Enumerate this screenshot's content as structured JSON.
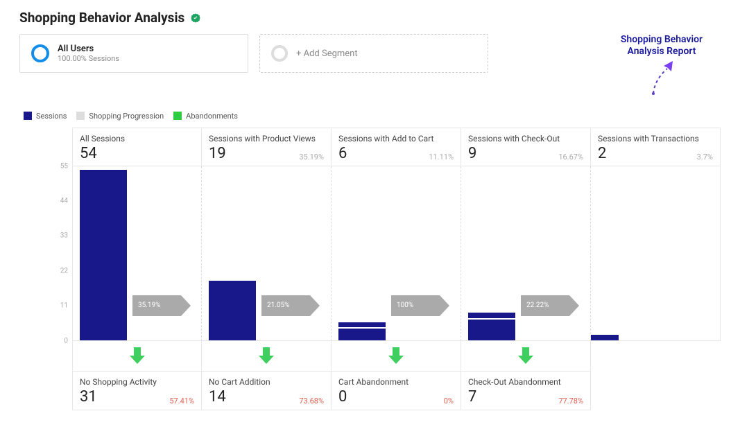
{
  "title": "Shopping Behavior Analysis",
  "segments": {
    "primary": {
      "name": "All Users",
      "sub": "100.00% Sessions"
    },
    "add_label": "+ Add Segment"
  },
  "report_link": "Shopping Behavior Analysis Report",
  "legend": {
    "sessions": "Sessions",
    "progression": "Shopping Progression",
    "abandonments": "Abandonments"
  },
  "yaxis": {
    "ticks": [
      "55",
      "44",
      "33",
      "22",
      "11",
      "0"
    ],
    "max": 55
  },
  "chart_data": {
    "type": "bar",
    "title": "Shopping Behavior Analysis",
    "ylim": [
      0,
      55
    ],
    "categories": [
      "All Sessions",
      "Sessions with Product Views",
      "Sessions with Add to Cart",
      "Sessions with Check-Out",
      "Sessions with Transactions"
    ],
    "series": [
      {
        "name": "Sessions",
        "values": [
          54,
          19,
          6,
          9,
          2
        ]
      }
    ],
    "progression_pct": [
      "35.19%",
      "21.05%",
      "100%",
      "22.22%"
    ],
    "stage_pct": [
      "",
      "35.19%",
      "11.11%",
      "16.67%",
      "3.7%"
    ],
    "abandonments": {
      "labels": [
        "No Shopping Activity",
        "No Cart Addition",
        "Cart Abandonment",
        "Check-Out Abandonment"
      ],
      "values": [
        31,
        14,
        0,
        7
      ],
      "pct": [
        "57.41%",
        "73.68%",
        "0%",
        "77.78%"
      ]
    }
  },
  "stages": [
    {
      "label": "All Sessions",
      "value": "54",
      "pct": ""
    },
    {
      "label": "Sessions with Product Views",
      "value": "19",
      "pct": "35.19%"
    },
    {
      "label": "Sessions with Add to Cart",
      "value": "6",
      "pct": "11.11%"
    },
    {
      "label": "Sessions with Check-Out",
      "value": "9",
      "pct": "16.67%"
    },
    {
      "label": "Sessions with Transactions",
      "value": "2",
      "pct": "3.7%"
    }
  ],
  "progression_labels": [
    "35.19%",
    "21.05%",
    "100%",
    "22.22%"
  ],
  "abandon": [
    {
      "label": "No Shopping Activity",
      "value": "31",
      "pct": "57.41%"
    },
    {
      "label": "No Cart Addition",
      "value": "14",
      "pct": "73.68%"
    },
    {
      "label": "Cart Abandonment",
      "value": "0",
      "pct": "0%"
    },
    {
      "label": "Check-Out Abandonment",
      "value": "7",
      "pct": "77.78%"
    }
  ]
}
